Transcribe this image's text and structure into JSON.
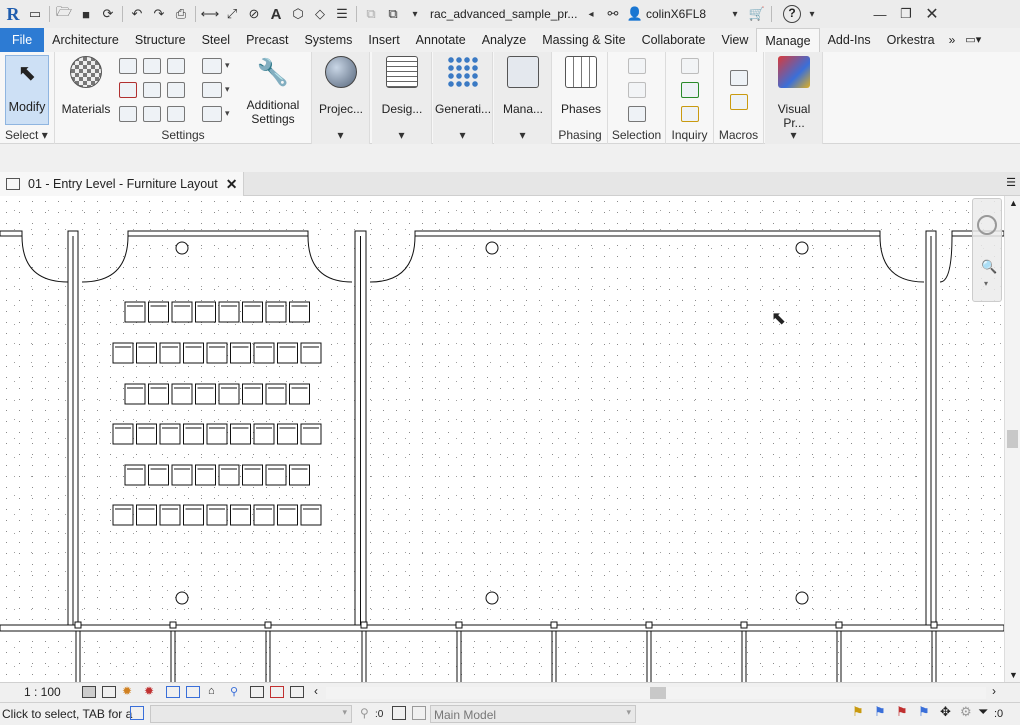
{
  "app": {
    "logo": "R",
    "file_name": "rac_advanced_sample_pr...",
    "user": "colinX6FL8",
    "help": "?"
  },
  "tabs": [
    "File",
    "Architecture",
    "Structure",
    "Steel",
    "Precast",
    "Systems",
    "Insert",
    "Annotate",
    "Analyze",
    "Massing & Site",
    "Collaborate",
    "View",
    "Manage",
    "Add-Ins",
    "Orkestra"
  ],
  "active_tab": "Manage",
  "ribbon": {
    "select": {
      "button": "Modify",
      "label": "Select"
    },
    "settings": {
      "materials": "Materials",
      "additional_line1": "Additional",
      "additional_line2": "Settings",
      "label": "Settings"
    },
    "project": "Projec...",
    "design": "Desig...",
    "generation": "Generati...",
    "manage": "Mana...",
    "phases": {
      "button": "Phases",
      "label": "Phasing"
    },
    "selection": {
      "label": "Selection"
    },
    "inquiry": {
      "label": "Inquiry"
    },
    "macros": {
      "label": "Macros"
    },
    "visual": "Visual Pr..."
  },
  "document_tab": "01 - Entry Level - Furniture Layout",
  "view_scale": "1 : 100",
  "status": {
    "message": "Click to select, TAB for a",
    "count": ":0",
    "model": "Main Model",
    "filter_count": ":0"
  },
  "colors": {
    "file_tab": "#2d7bd3",
    "ribbon": "#f7f7f7",
    "canvas": "#ffffff"
  }
}
